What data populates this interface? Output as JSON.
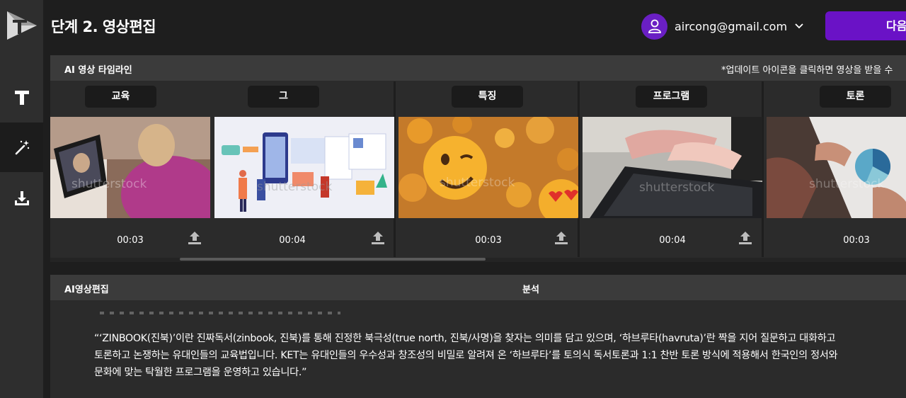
{
  "header": {
    "title": "단계 2. 영상편집",
    "account_email": "aircong@gmail.com",
    "next_button_label": "다음"
  },
  "sidebar": {
    "items": [
      {
        "icon": "text-icon"
      },
      {
        "icon": "magic-wand-icon"
      },
      {
        "icon": "download-icon"
      }
    ]
  },
  "timeline": {
    "title": "AI 영상 타임라인",
    "note": "*업데이트 아이콘을 클릭하면 영상을 받을 수",
    "clips": [
      {
        "keyword": "교육",
        "duration": "00:03",
        "thumbnail": "woman-tablet-video-call"
      },
      {
        "keyword": "그",
        "duration": "00:04",
        "thumbnail": "people-web-illustration"
      },
      {
        "keyword": "특징",
        "duration": "00:03",
        "thumbnail": "emoji-faces"
      },
      {
        "keyword": "프로그램",
        "duration": "00:04",
        "thumbnail": "hands-typing-keyboard"
      },
      {
        "keyword": "토론",
        "duration": "00:03",
        "thumbnail": "hands-pie-chart-documents"
      }
    ],
    "watermark": "shutterstock"
  },
  "edit": {
    "title": "AI영상편집",
    "center_label": "분석",
    "quote_lines": [
      "“‘ZINBOOK(진북)’이란 진짜독서(zinbook, 진북)를 통해 진정한 북극성(true north, 진북/사명)을 찾자는 의미를 담고 있으며, ‘하브루타(havruta)’란 짝을 지어 질문하고 대화하고",
      "토론하고 논쟁하는 유대인들의 교육법입니다. KET는 유대인들의 우수성과 창조성의 비밀로 알려져 온 ‘하브루타’를 토의식 독서토론과 1:1 찬반 토론 방식에 적용해서 한국인의 정서와",
      "문화에 맞는 탁월한 프로그램을 운영하고 있습니다.”"
    ]
  },
  "colors": {
    "accent": "#6a12c6",
    "background": "#1e1e1e",
    "panel": "#2b2b2b",
    "panel_header": "#3b3b3b"
  }
}
